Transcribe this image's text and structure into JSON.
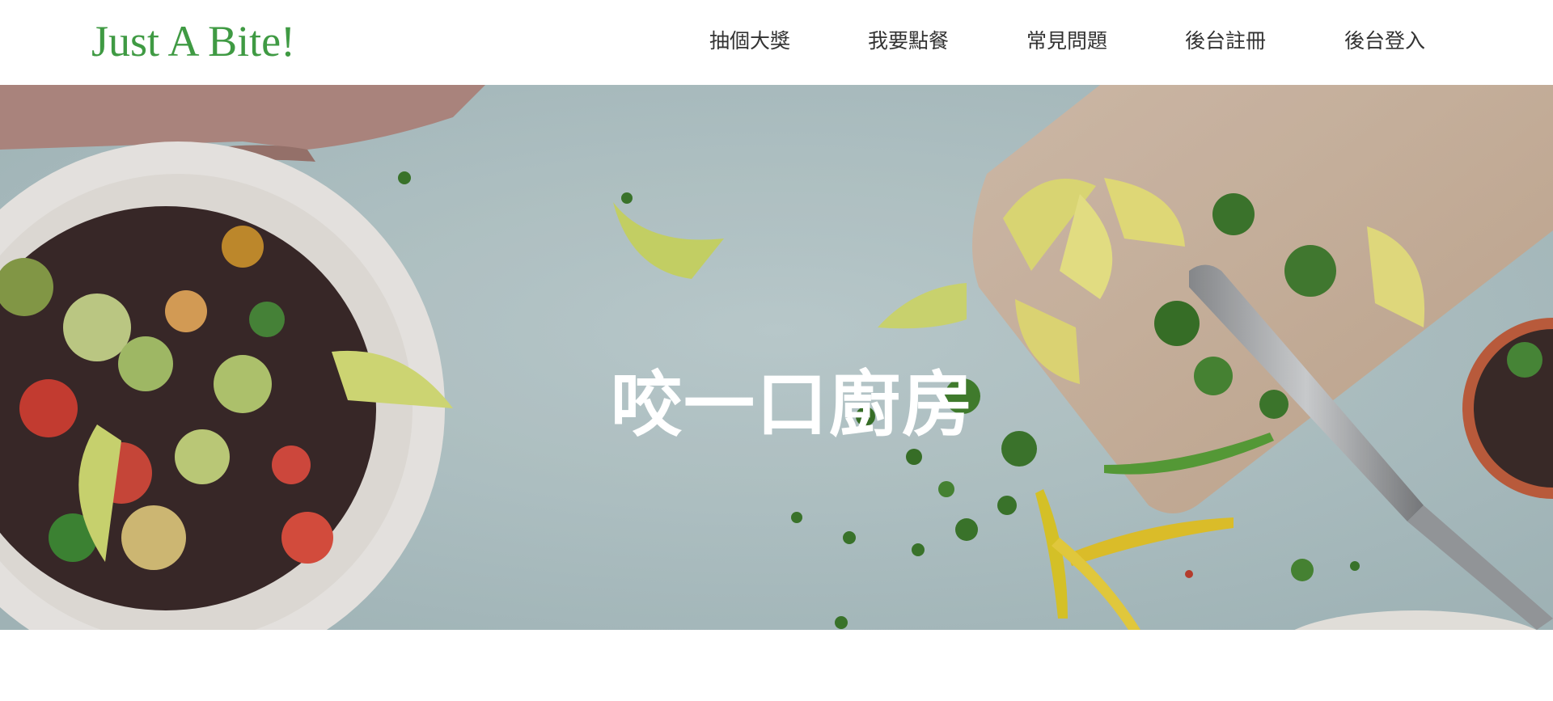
{
  "brand": {
    "name": "Just A Bite!"
  },
  "nav": {
    "items": [
      "抽個大獎",
      "我要點餐",
      "常見問題",
      "後台註冊",
      "後台登入"
    ]
  },
  "hero": {
    "title": "咬一口廚房",
    "image_icon": "food-table-photo"
  },
  "colors": {
    "brand": "#3f9a43",
    "nav_text": "#333333",
    "hero_bg": "#b6c9cc",
    "hero_title": "#ffffff"
  }
}
